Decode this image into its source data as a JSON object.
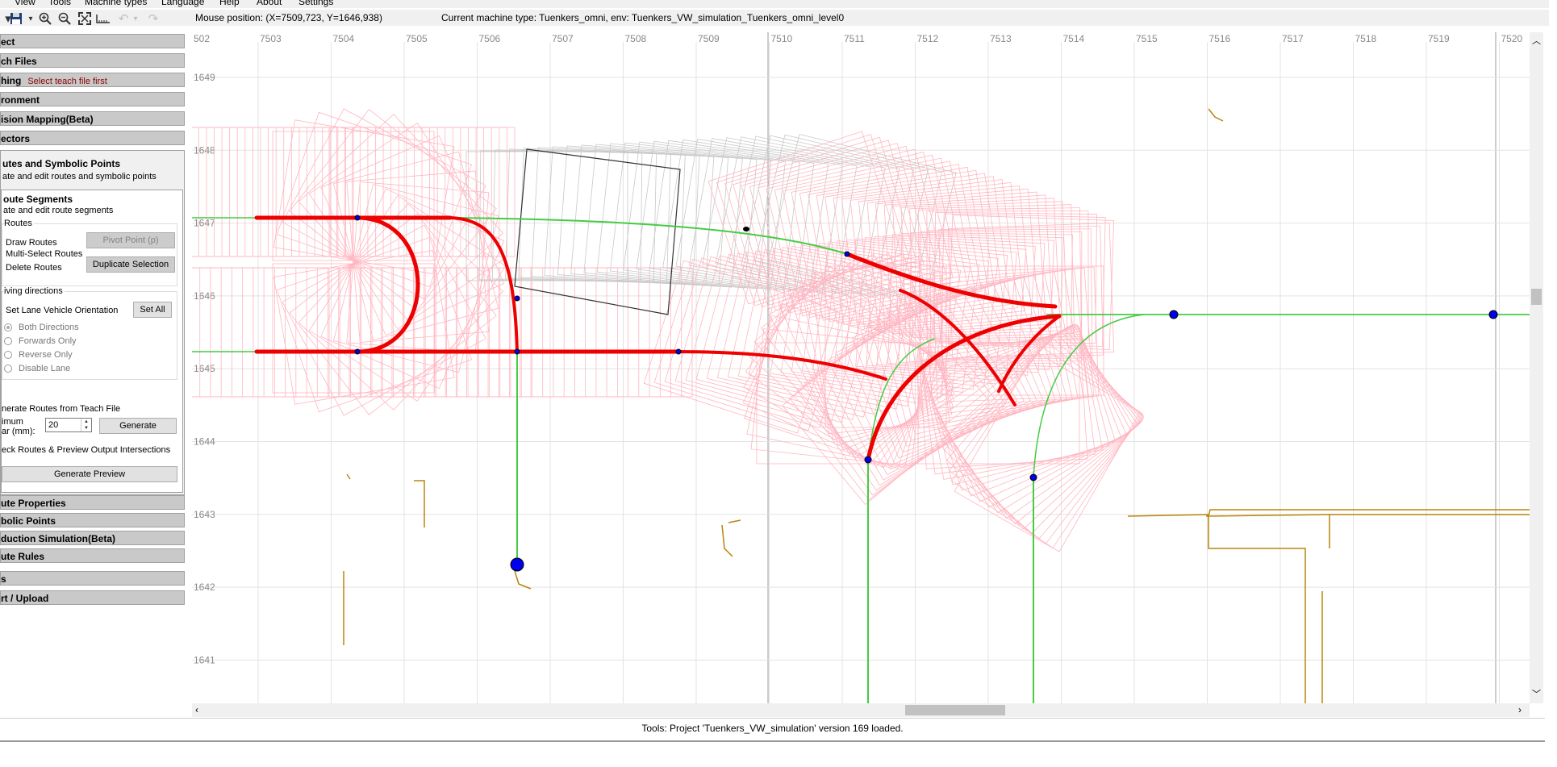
{
  "menu": {
    "items": [
      "View",
      "Tools",
      "Machine types",
      "Language",
      "Help",
      "About",
      "Settings"
    ]
  },
  "toolbar": {
    "icons": [
      "save-dropdown-icon",
      "zoom-in-icon",
      "zoom-out-icon",
      "fit-to-screen-icon",
      "measure-icon",
      "undo-icon",
      "redo-icon"
    ]
  },
  "header": {
    "mouse_position": "Mouse position: (X=7509,723, Y=1646,938)",
    "machine_type": "Current machine type: Tuenkers_omni, env: Tuenkers_VW_simulation_Tuenkers_omni_level0"
  },
  "sidebar": {
    "sections_top": [
      {
        "label": "ect"
      },
      {
        "label": "ch Files"
      },
      {
        "label": "hing",
        "hint": "Select teach file first"
      },
      {
        "label": "ronment"
      },
      {
        "label": "ision Mapping(Beta)"
      },
      {
        "label": "ectors"
      }
    ],
    "routes_title": "utes and Symbolic Points",
    "routes_desc": "ate and edit routes and symbolic points",
    "segments_title": "oute Segments",
    "segments_desc": "ate and edit route segments",
    "routes_group": "Routes",
    "draw_routes": "Draw Routes",
    "multi_select": "Multi-Select Routes",
    "delete_routes": "Delete Routes",
    "pivot_button": "Pivot Point (p)",
    "duplicate_button": "Duplicate Selection",
    "driving_group": "iving directions",
    "lane_orientation": "Set Lane Vehicle Orientation",
    "set_all": "Set All",
    "directions": [
      {
        "label": "Both Directions",
        "selected": true
      },
      {
        "label": "Forwards Only",
        "selected": false
      },
      {
        "label": "Reverse Only",
        "selected": false
      },
      {
        "label": "Disable Lane",
        "selected": false
      }
    ],
    "generate_group": "nerate Routes from Teach File",
    "min_label_1": "imum",
    "min_label_2": "ar (mm):",
    "min_value": "20",
    "generate_button": "Generate",
    "check_group": "eck Routes & Preview Output Intersections",
    "preview_button": "Generate Preview",
    "sections_bottom": [
      {
        "label": "ute Properties"
      },
      {
        "label": "bolic Points"
      },
      {
        "label": "duction Simulation(Beta)"
      },
      {
        "label": "ute Rules"
      },
      {
        "label": "s"
      },
      {
        "label": "rt / Upload"
      }
    ]
  },
  "map": {
    "x_ticks": [
      "502",
      "7503",
      "7504",
      "7505",
      "7506",
      "7507",
      "7508",
      "7509",
      "7510",
      "7511",
      "7512",
      "7513",
      "7514",
      "7515",
      "7516",
      "7517",
      "7518",
      "7519",
      "7520"
    ],
    "y_ticks": [
      "1649",
      "1648",
      "1647",
      "1646",
      "1645",
      "1644",
      "1643",
      "1642",
      "1641"
    ],
    "colors": {
      "grid": "#e3e3e3",
      "route_selected": "#ee0000",
      "route": "#44cc44",
      "footprint": "#ffb6c1",
      "machine": "#888888",
      "obstacle": "#b8860b",
      "node": "#0000ee"
    }
  },
  "status": {
    "text": "Tools: Project 'Tuenkers_VW_simulation' version 169 loaded."
  }
}
